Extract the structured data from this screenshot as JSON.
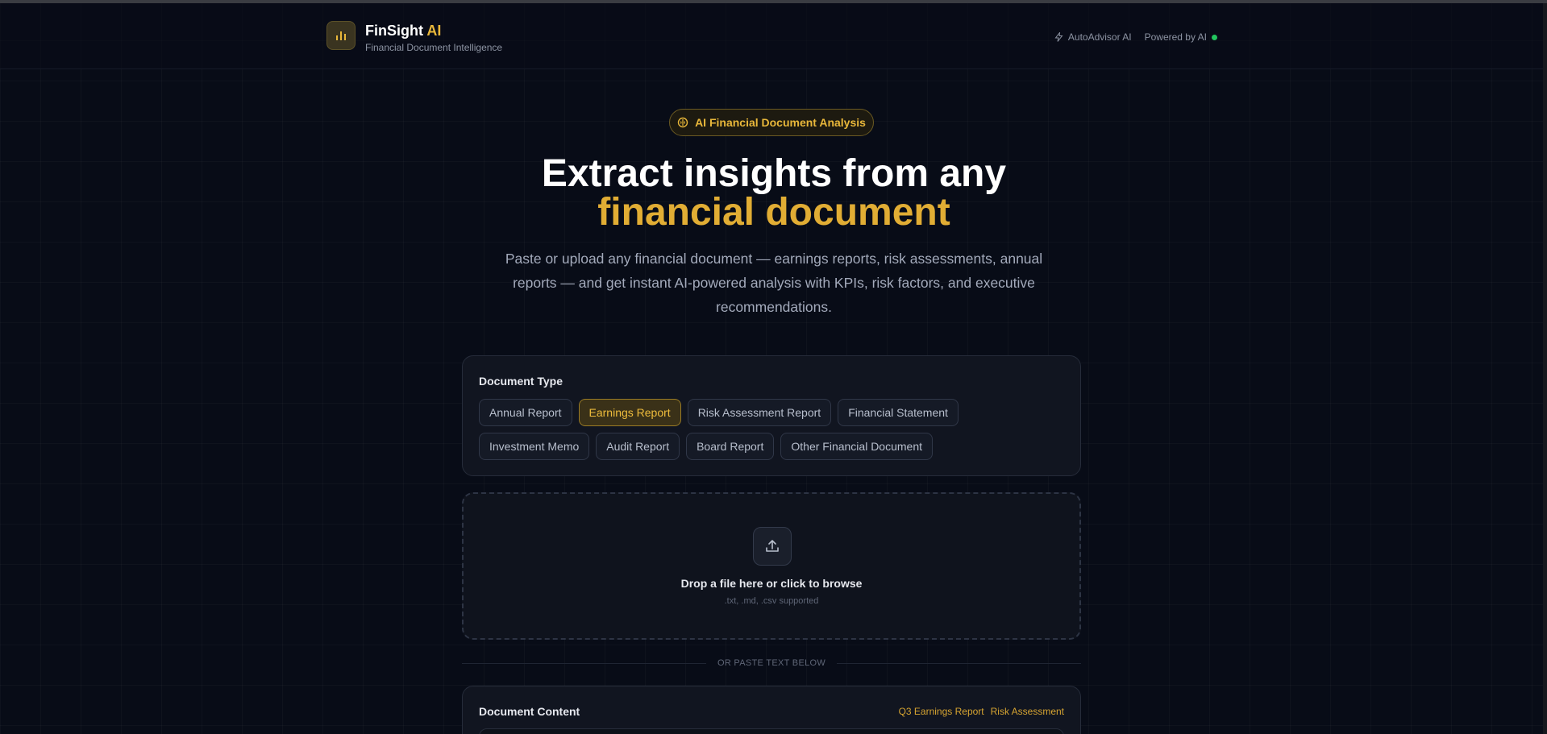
{
  "header": {
    "brand_name": "FinSight",
    "brand_accent": "AI",
    "brand_subtitle": "Financial Document Intelligence",
    "logo_icon": "bar-chart-icon",
    "autoadvisor_label": "AutoAdvisor AI",
    "autoadvisor_icon": "lightning-icon",
    "powered_by_label": "Powered by AI",
    "status_color": "#22c55e"
  },
  "hero": {
    "pill_label": "AI Financial Document Analysis",
    "pill_icon": "brain-icon",
    "title_line1": "Extract insights from any",
    "title_line2": "financial document",
    "description": "Paste or upload any financial document — earnings reports, risk assessments, annual reports — and get instant AI-powered analysis with KPIs, risk factors, and executive recommendations."
  },
  "document_type": {
    "title": "Document Type",
    "options": [
      "Annual Report",
      "Earnings Report",
      "Risk Assessment Report",
      "Financial Statement",
      "Investment Memo",
      "Audit Report",
      "Board Report",
      "Other Financial Document"
    ],
    "selected": "Earnings Report"
  },
  "dropzone": {
    "icon": "upload-icon",
    "title": "Drop a file here or click to browse",
    "subtitle": ".txt, .md, .csv supported"
  },
  "divider_text": "OR PASTE TEXT BELOW",
  "content": {
    "title": "Document Content",
    "samples": [
      "Q3 Earnings Report",
      "Risk Assessment"
    ]
  },
  "colors": {
    "accent": "#e8b73a",
    "background": "#080c17",
    "card": "#111520"
  }
}
